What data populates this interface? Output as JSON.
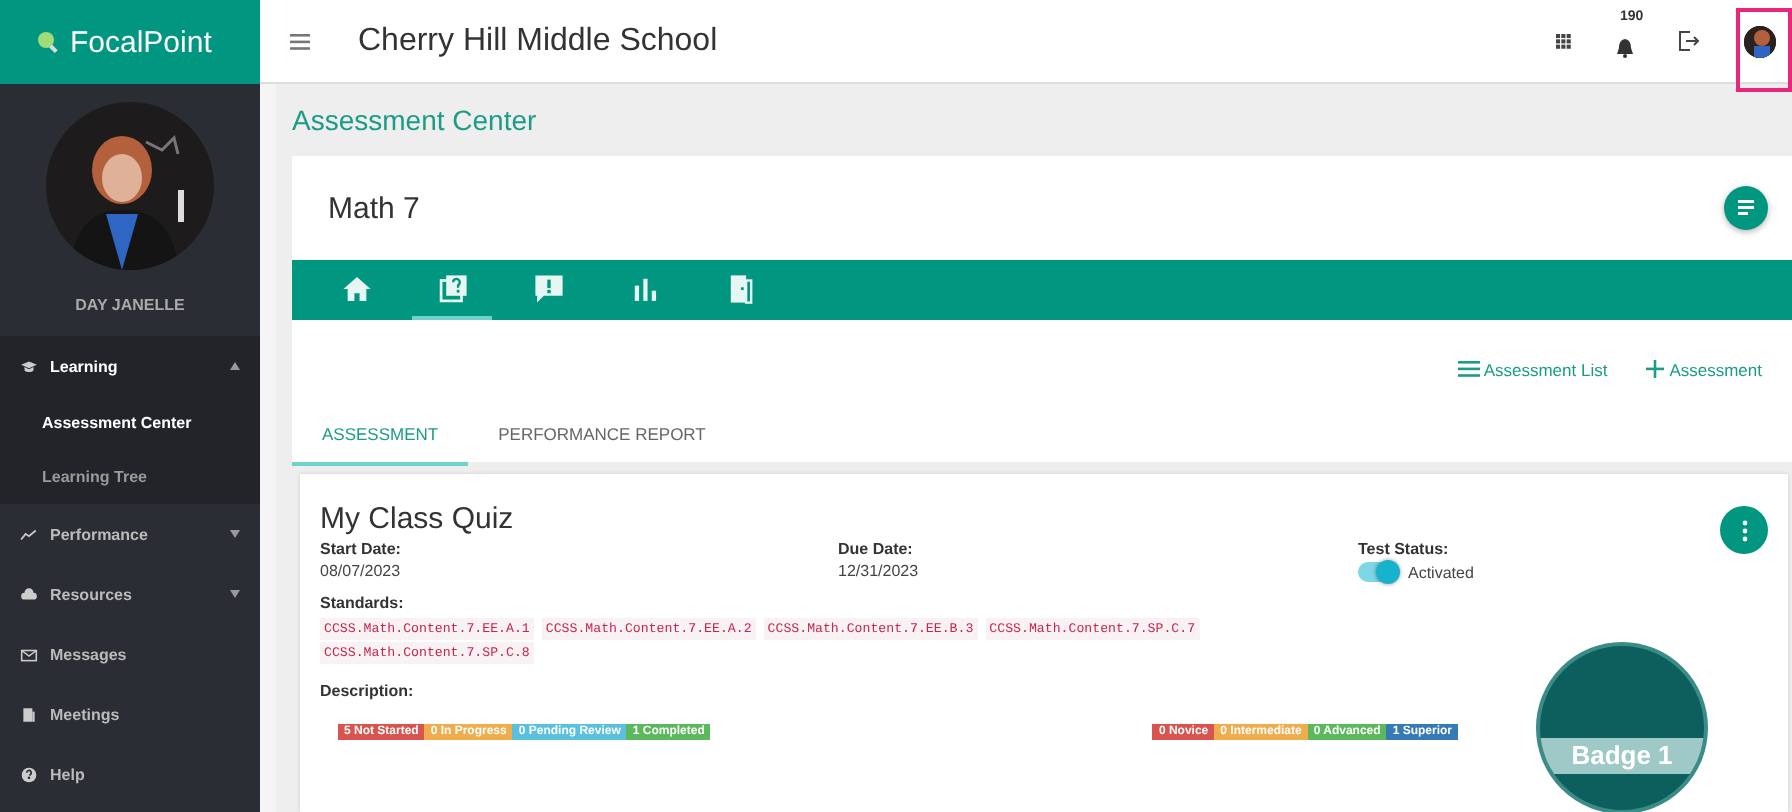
{
  "brand": {
    "name": "FocalPoint"
  },
  "topbar": {
    "school": "Cherry Hill Middle School",
    "notification_count": "190",
    "avatar_highlighted": true
  },
  "sidebar": {
    "user_name": "DAY JANELLE",
    "items": [
      {
        "kind": "group",
        "label": "Learning",
        "expanded": true,
        "children": [
          {
            "label": "Assessment Center",
            "selected": true
          },
          {
            "label": "Learning Tree",
            "selected": false
          }
        ]
      },
      {
        "kind": "group",
        "label": "Performance",
        "expanded": false
      },
      {
        "kind": "group",
        "label": "Resources",
        "expanded": false
      },
      {
        "kind": "link",
        "label": "Messages"
      },
      {
        "kind": "link",
        "label": "Meetings"
      },
      {
        "kind": "link",
        "label": "Help"
      }
    ]
  },
  "breadcrumb": "Assessment Center",
  "course": {
    "title": "Math 7",
    "icon_tabs": [
      {
        "selected": false
      },
      {
        "selected": true
      },
      {
        "selected": false
      },
      {
        "selected": false
      },
      {
        "selected": false
      }
    ]
  },
  "actions": [
    "Assessment List",
    "Assessment"
  ],
  "tabs": [
    {
      "label": "ASSESSMENT",
      "selected": true
    },
    {
      "label": "PERFORMANCE REPORT",
      "selected": false
    }
  ],
  "quiz": {
    "title": "My Class Quiz",
    "start_date": {
      "label": "Start Date:",
      "value": "08/07/2023"
    },
    "due_date": {
      "label": "Due Date:",
      "value": "12/31/2023"
    },
    "test_status": {
      "label": "Test Status:",
      "on": true,
      "text": "Activated"
    },
    "standards_label": "Standards:",
    "standards": [
      "CCSS.Math.Content.7.EE.A.1",
      "CCSS.Math.Content.7.EE.A.2",
      "CCSS.Math.Content.7.EE.B.3",
      "CCSS.Math.Content.7.SP.C.7",
      "CCSS.Math.Content.7.SP.C.8"
    ],
    "description_label": "Description:",
    "progress": [
      {
        "label": "5 Not Started",
        "color": "#d9534f"
      },
      {
        "label": "0 In Progress",
        "color": "#f0ad4e"
      },
      {
        "label": "0 Pending Review",
        "color": "#5bc0de"
      },
      {
        "label": "1 Completed",
        "color": "#5cb85c"
      }
    ],
    "levels": [
      {
        "label": "0 Novice",
        "color": "#d9534f"
      },
      {
        "label": "0 Intermediate",
        "color": "#f0ad4e"
      },
      {
        "label": "0 Advanced",
        "color": "#5cb85c"
      },
      {
        "label": "1 Superior",
        "color": "#337ab7"
      }
    ],
    "badge": "Badge 1"
  }
}
